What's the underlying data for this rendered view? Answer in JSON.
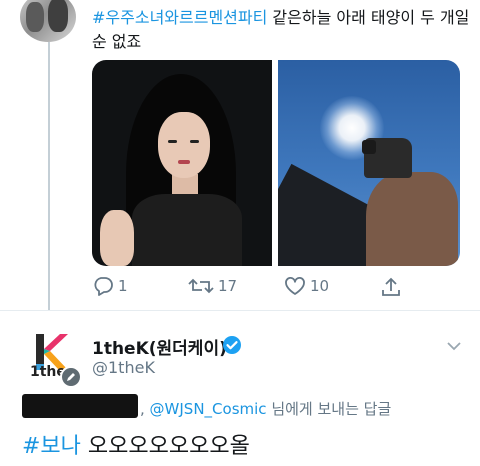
{
  "original_tweet": {
    "hashtag": "#우주소녀와르르멘션파티",
    "text": " 같은하늘 아래 태양이 두 개일순 없죠",
    "actions": [
      {
        "icon": "reply-icon",
        "count": "1"
      },
      {
        "icon": "retweet-icon",
        "count": "17"
      },
      {
        "icon": "like-icon",
        "count": "10"
      },
      {
        "icon": "share-icon",
        "count": ""
      }
    ]
  },
  "reply": {
    "display_name": "1theK(원더케이)",
    "handle": "@1theK",
    "logo_text": "1the",
    "replying_to_prefix": ", ",
    "replying_to_handle": "@WJSN_Cosmic",
    "replying_to_suffix": " 님에게 보내는 답글",
    "hashtag": "#보나",
    "text": " 오오오오오오오올"
  },
  "colors": {
    "link": "#1b95e0",
    "muted": "#657786",
    "verified": "#1da1f2"
  }
}
